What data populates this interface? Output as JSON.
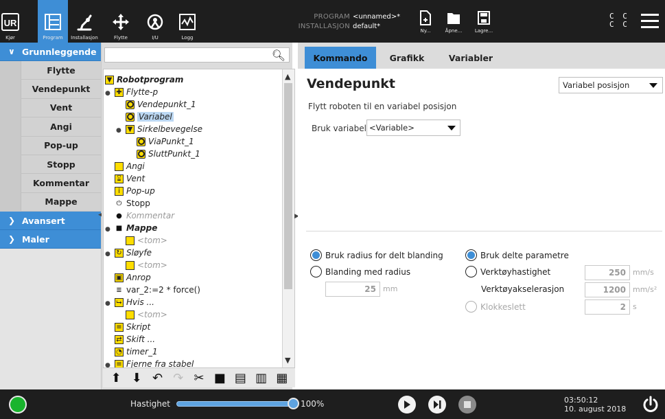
{
  "topbar": {
    "nav": [
      {
        "id": "run",
        "label": "Kjør",
        "icon": "ur-logo-icon"
      },
      {
        "id": "program",
        "label": "Program",
        "icon": "program-tree-icon",
        "active": true
      },
      {
        "id": "installation",
        "label": "Installasjon",
        "icon": "robot-arm-icon"
      },
      {
        "id": "move",
        "label": "Flytte",
        "icon": "move-cross-icon"
      },
      {
        "id": "io",
        "label": "I/U",
        "icon": "io-icon"
      },
      {
        "id": "log",
        "label": "Logg",
        "icon": "log-graph-icon"
      }
    ],
    "program_key": "PROGRAM",
    "program_value": "<unnamed>*",
    "installation_key": "INSTALLASJON",
    "installation_value": "default*",
    "file_buttons": [
      {
        "id": "new",
        "label": "Ny...",
        "icon": "new-file-icon"
      },
      {
        "id": "open",
        "label": "Åpne...",
        "icon": "folder-icon"
      },
      {
        "id": "save",
        "label": "Lagre...",
        "icon": "save-icon"
      }
    ],
    "cc_line1": "C C",
    "cc_line2": "C C"
  },
  "sidebar": {
    "groups": [
      {
        "label": "Grunnleggende",
        "expanded": true,
        "items": [
          "Flytte",
          "Vendepunkt",
          "Vent",
          "Angi",
          "Pop-up",
          "Stopp",
          "Kommentar",
          "Mappe"
        ]
      },
      {
        "label": "Avansert",
        "expanded": false,
        "items": []
      },
      {
        "label": "Maler",
        "expanded": false,
        "items": []
      }
    ]
  },
  "tree": {
    "search_placeholder": "",
    "rows": [
      {
        "text": "Robotprogram",
        "icon": "yellow-triangle",
        "style": "bold"
      },
      {
        "text": "Flytte-p",
        "icon": "move"
      },
      {
        "text": "Vendepunkt_1",
        "icon": "waypoint"
      },
      {
        "text": "Variabel",
        "icon": "waypoint",
        "selected": true
      },
      {
        "text": "Sirkelbevegelse",
        "icon": "yellow-triangle"
      },
      {
        "text": "ViaPunkt_1",
        "icon": "waypoint"
      },
      {
        "text": "SluttPunkt_1",
        "icon": "waypoint"
      },
      {
        "text": "Angi",
        "icon": "set"
      },
      {
        "text": "Vent",
        "icon": "wait"
      },
      {
        "text": "Pop-up",
        "icon": "popup"
      },
      {
        "text": "Stopp",
        "icon": "stop",
        "style": "upright"
      },
      {
        "text": "Kommentar",
        "icon": "comment",
        "style": "grey"
      },
      {
        "text": "Mappe",
        "icon": "folder",
        "style": "bold"
      },
      {
        "text": "<tom>",
        "icon": "empty",
        "style": "grey"
      },
      {
        "text": "Sløyfe",
        "icon": "loop"
      },
      {
        "text": "<tom>",
        "icon": "empty",
        "style": "grey"
      },
      {
        "text": "Anrop",
        "icon": "call"
      },
      {
        "text": "var_2:=2 * force()",
        "icon": "assign",
        "style": "upright"
      },
      {
        "text": "Hvis ...",
        "icon": "if"
      },
      {
        "text": "<tom>",
        "icon": "empty",
        "style": "grey"
      },
      {
        "text": "Skript",
        "icon": "script"
      },
      {
        "text": "Skift ...",
        "icon": "switch"
      },
      {
        "text": "timer_1",
        "icon": "timer"
      },
      {
        "text": "Fjerne fra stabel",
        "icon": "pallet"
      }
    ],
    "toolbar": [
      "move-up-icon",
      "move-down-icon",
      "undo-icon",
      "redo-icon",
      "cut-icon",
      "copy-icon",
      "paste-icon",
      "delete-icon",
      "suppress-icon"
    ]
  },
  "tabs": [
    "Kommando",
    "Grafikk",
    "Variabler"
  ],
  "command": {
    "title": "Vendepunkt",
    "type_select": "Variabel posisjon",
    "description": "Flytt roboten til en variabel posisjon",
    "var_label": "Bruk variabel",
    "var_select": "<Variable>"
  },
  "blend": {
    "shared_radius_label": "Bruk radius for delt blanding",
    "blend_radius_label": "Blanding med radius",
    "radius_value": "25",
    "radius_unit": "mm"
  },
  "params": {
    "shared_params_label": "Bruk delte parametre",
    "tool_speed_label": "Verktøyhastighet",
    "tool_speed_value": "250",
    "tool_speed_unit": "mm/s",
    "tool_accel_label": "Verktøyakselerasjon",
    "tool_accel_value": "1200",
    "tool_accel_unit": "mm/s²",
    "time_label": "Klokkeslett",
    "time_value": "2",
    "time_unit": "s"
  },
  "bottombar": {
    "speed_label": "Hastighet",
    "speed_percent": "100%",
    "speed_fraction": 1.0,
    "time": "03:50:12",
    "date": "10. august 2018"
  },
  "colors": {
    "accent": "#3e8ed6",
    "topbar": "#1e1e1e",
    "power_on": "#19b42d",
    "tree_yellow": "#ffdd00"
  }
}
